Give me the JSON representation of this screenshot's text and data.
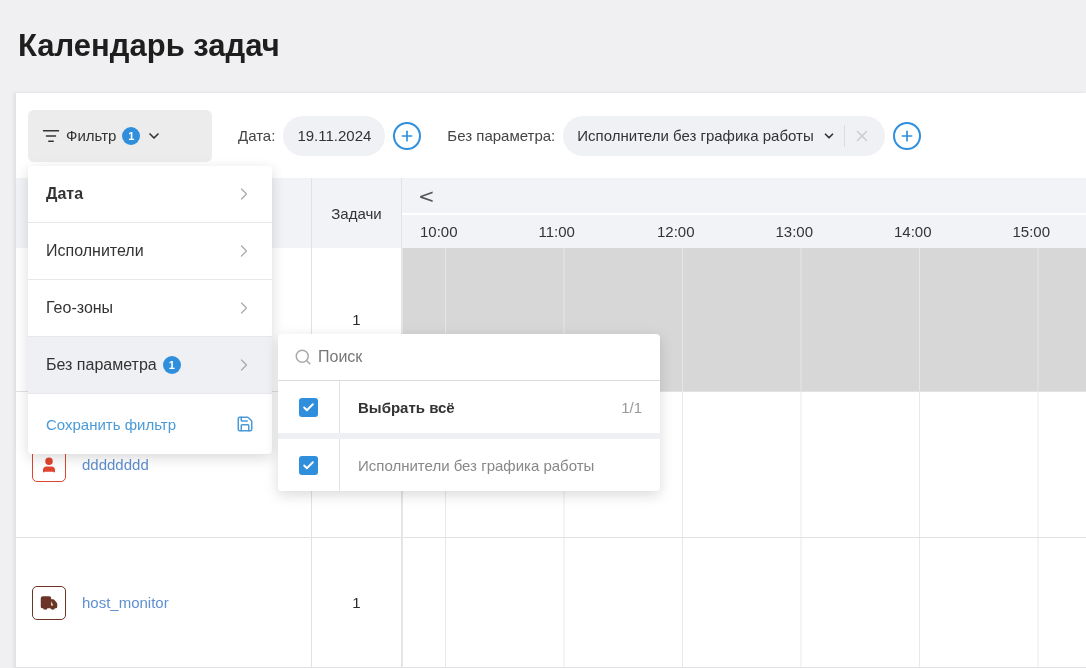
{
  "title": "Календарь задач",
  "toolbar": {
    "filter_button": {
      "label": "Фильтр",
      "badge": "1"
    },
    "date": {
      "label": "Дата:",
      "value": "19.11.2024"
    },
    "param": {
      "label": "Без параметра:",
      "value": "Исполнители без графика работы"
    }
  },
  "filter_menu": {
    "items": [
      {
        "label": "Дата",
        "bold": true,
        "selected": false
      },
      {
        "label": "Исполнители",
        "bold": false,
        "selected": false
      },
      {
        "label": "Гео-зоны",
        "bold": false,
        "selected": false
      },
      {
        "label": "Без параметра",
        "badge": "1",
        "bold": false,
        "selected": true
      }
    ],
    "save": "Сохранить фильтр"
  },
  "submenu": {
    "placeholder": "Поиск",
    "select_all": {
      "label": "Выбрать всё",
      "count": "1/1",
      "checked": true
    },
    "options": [
      {
        "label": "Исполнители без графика работы",
        "checked": true
      }
    ]
  },
  "table": {
    "tasks_header": "Задачи",
    "prev": "<",
    "hours": [
      "10:00",
      "11:00",
      "12:00",
      "13:00",
      "14:00",
      "15:00"
    ],
    "rows": [
      {
        "tasks": "1",
        "busy": true
      },
      {
        "name": "dddddddd",
        "kind": "worker",
        "color": "#e0452f",
        "busy": false
      },
      {
        "name": "host_monitor",
        "kind": "truck",
        "color": "#6b3426",
        "tasks": "1",
        "busy": false
      }
    ]
  }
}
